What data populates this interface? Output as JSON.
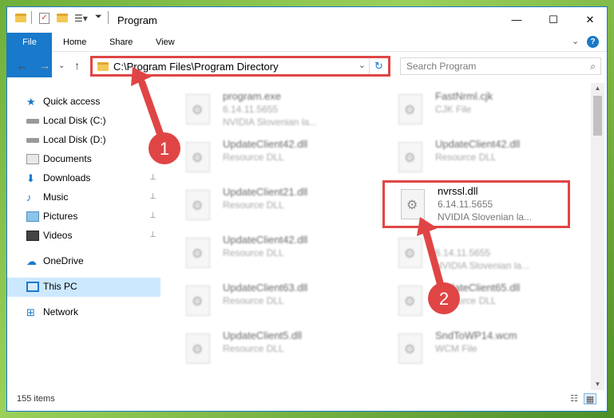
{
  "window": {
    "title": "Program",
    "controls": {
      "minimize": "—",
      "maximize": "☐",
      "close": "✕"
    }
  },
  "ribbon": {
    "tabs": [
      "File",
      "Home",
      "Share",
      "View"
    ],
    "expand_glyph": "⌄",
    "help_glyph": "?"
  },
  "navigation": {
    "back": "←",
    "forward": "→",
    "recent": "⌄",
    "up": "↑",
    "address": "C:\\Program Files\\Program Directory",
    "address_dropdown": "⌄",
    "refresh": "↻",
    "search_placeholder": "Search Program",
    "search_glyph": "⌕"
  },
  "sidebar": {
    "items": [
      {
        "label": "Quick access",
        "icon": "star-icon",
        "pinned": false
      },
      {
        "label": "Local Disk (C:)",
        "icon": "drive-icon",
        "pinned": false
      },
      {
        "label": "Local Disk (D:)",
        "icon": "drive-icon",
        "pinned": false
      },
      {
        "label": "Documents",
        "icon": "documents-icon",
        "pinned": false
      },
      {
        "label": "Downloads",
        "icon": "download-icon",
        "pinned": true
      },
      {
        "label": "Music",
        "icon": "music-icon",
        "pinned": true
      },
      {
        "label": "Pictures",
        "icon": "pictures-icon",
        "pinned": true
      },
      {
        "label": "Videos",
        "icon": "videos-icon",
        "pinned": true
      },
      {
        "label": "OneDrive",
        "icon": "cloud-icon",
        "pinned": false
      },
      {
        "label": "This PC",
        "icon": "monitor-icon",
        "pinned": false,
        "selected": true
      },
      {
        "label": "Network",
        "icon": "network-icon",
        "pinned": false
      }
    ],
    "pin_glyph": "📌"
  },
  "files": [
    {
      "name": "program.exe",
      "line2": "6.14.11.5655",
      "line3": "NVIDIA Slovenian la...",
      "col": 0,
      "row": 0
    },
    {
      "name": "FastNrml.cjk",
      "line2": "CJK File",
      "line3": "",
      "col": 1,
      "row": 0
    },
    {
      "name": "UpdateClient42.dll",
      "line2": "Resource DLL",
      "line3": "",
      "col": 0,
      "row": 1
    },
    {
      "name": "UpdateClient42.dll",
      "line2": "Resource DLL",
      "line3": "",
      "col": 1,
      "row": 1
    },
    {
      "name": "UpdateClient21.dll",
      "line2": "Resource DLL",
      "line3": "",
      "col": 0,
      "row": 2
    },
    {
      "name": "nvrssl.dll",
      "line2": "6.14.11.5655",
      "line3": "NVIDIA Slovenian la...",
      "col": 1,
      "row": 2,
      "highlighted": true
    },
    {
      "name": "UpdateClient42.dll",
      "line2": "Resource DLL",
      "line3": "",
      "col": 0,
      "row": 3
    },
    {
      "name": "",
      "line2": "6.14.11.5655",
      "line3": "NVIDIA Slovenian la...",
      "col": 1,
      "row": 3
    },
    {
      "name": "UpdateClient63.dll",
      "line2": "Resource DLL",
      "line3": "",
      "col": 0,
      "row": 4
    },
    {
      "name": "UpdateClient65.dll",
      "line2": "Resource DLL",
      "line3": "",
      "col": 1,
      "row": 4
    },
    {
      "name": "UpdateClient5.dll",
      "line2": "Resource DLL",
      "line3": "",
      "col": 0,
      "row": 5
    },
    {
      "name": "SndToWP14.wcm",
      "line2": "WCM File",
      "line3": "",
      "col": 1,
      "row": 5
    }
  ],
  "status": {
    "item_count": "155 items"
  },
  "annotations": [
    {
      "number": "1",
      "color": "#e04545"
    },
    {
      "number": "2",
      "color": "#e04545"
    }
  ]
}
